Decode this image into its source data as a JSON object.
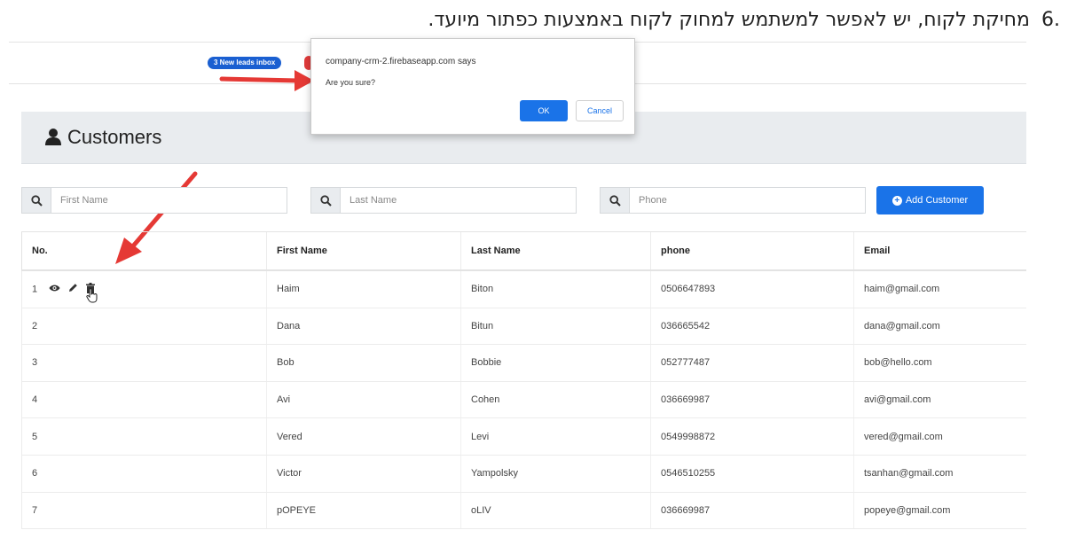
{
  "instruction": {
    "number": ".6",
    "text": "מחיקת לקוח, יש לאפשר למשתמש למחוק לקוח באמצעות כפתור מיועד."
  },
  "topbar": {
    "leads_badge": "3 New leads inbox"
  },
  "dialog": {
    "origin": "company-crm-2.firebaseapp.com says",
    "message": "Are you sure?",
    "ok_label": "OK",
    "cancel_label": "Cancel"
  },
  "page": {
    "title": "Customers",
    "icon": "user-icon"
  },
  "search": {
    "first_name_placeholder": "First Name",
    "last_name_placeholder": "Last Name",
    "phone_placeholder": "Phone",
    "icon": "search-icon"
  },
  "add_customer_label": "Add Customer",
  "table": {
    "headers": [
      "No.",
      "First Name",
      "Last Name",
      "phone",
      "Email"
    ],
    "rows": [
      {
        "no": "1",
        "first": "Haim",
        "last": "Biton",
        "phone": "0506647893",
        "email": "haim@gmail.com"
      },
      {
        "no": "2",
        "first": "Dana",
        "last": "Bitun",
        "phone": "036665542",
        "email": "dana@gmail.com"
      },
      {
        "no": "3",
        "first": "Bob",
        "last": "Bobbie",
        "phone": "052777487",
        "email": "bob@hello.com"
      },
      {
        "no": "4",
        "first": "Avi",
        "last": "Cohen",
        "phone": "036669987",
        "email": "avi@gmail.com"
      },
      {
        "no": "5",
        "first": "Vered",
        "last": "Levi",
        "phone": "0549998872",
        "email": "vered@gmail.com"
      },
      {
        "no": "6",
        "first": "Victor",
        "last": "Yampolsky",
        "phone": "0546510255",
        "email": "tsanhan@gmail.com"
      },
      {
        "no": "7",
        "first": "pOPEYE",
        "last": "oLIV",
        "phone": "036669987",
        "email": "popeye@gmail.com"
      }
    ],
    "row_action_icons": [
      "eye-icon",
      "pencil-icon",
      "trash-icon"
    ]
  },
  "colors": {
    "accent": "#1a73e8",
    "annotation_arrow": "#e53935",
    "header_band": "#e9ecef"
  }
}
